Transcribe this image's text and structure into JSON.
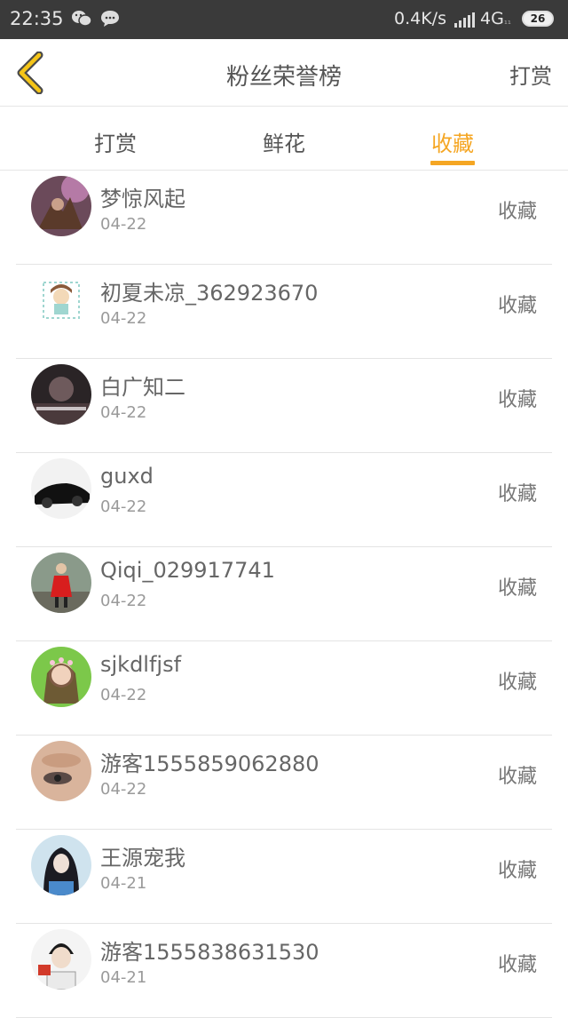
{
  "status_bar": {
    "time": "22:35",
    "net_speed": "0.4K/s",
    "network": "4G",
    "network_sub": "₁₁",
    "battery": "26"
  },
  "nav": {
    "title": "粉丝荣誉榜",
    "right_action": "打赏"
  },
  "tabs": [
    {
      "label": "打赏",
      "active": false
    },
    {
      "label": "鲜花",
      "active": false
    },
    {
      "label": "收藏",
      "active": true
    }
  ],
  "accent_color": "#f5a623",
  "rows": [
    {
      "name": "梦惊风起",
      "date": "04-22",
      "action": "收藏",
      "avatar": "fantasy-warrior"
    },
    {
      "name": "初夏未凉_362923670",
      "date": "04-22",
      "action": "收藏",
      "avatar": "cartoon-girl"
    },
    {
      "name": "白广知二",
      "date": "04-22",
      "action": "收藏",
      "avatar": "dark-portrait"
    },
    {
      "name": "guxd",
      "date": "04-22",
      "action": "收藏",
      "avatar": "black-car"
    },
    {
      "name": "Qiqi_029917741",
      "date": "04-22",
      "action": "收藏",
      "avatar": "girl-red-coat"
    },
    {
      "name": "sjkdlfjsf",
      "date": "04-22",
      "action": "收藏",
      "avatar": "girl-flower-crown"
    },
    {
      "name": "游客1555859062880",
      "date": "04-22",
      "action": "收藏",
      "avatar": "eye-closeup"
    },
    {
      "name": "王源宠我",
      "date": "04-21",
      "action": "收藏",
      "avatar": "dark-hair-girl"
    },
    {
      "name": "游客1555838631530",
      "date": "04-21",
      "action": "收藏",
      "avatar": "boy-portrait"
    }
  ]
}
